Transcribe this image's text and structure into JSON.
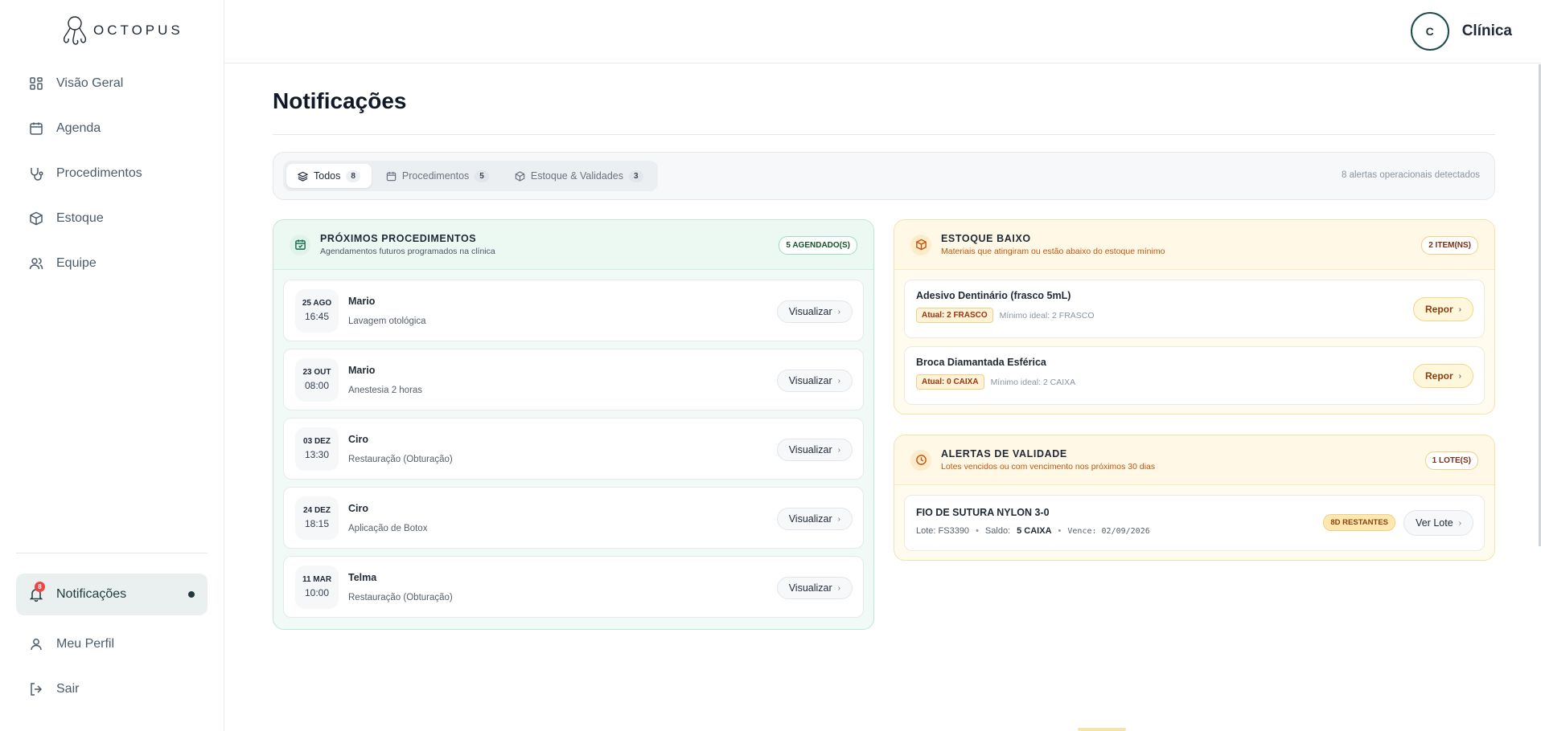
{
  "brand": {
    "name": "OCTOPUS",
    "logo_icon": "octopus-icon"
  },
  "sidebar": {
    "items": [
      {
        "label": "Visão Geral",
        "icon": "grid-icon"
      },
      {
        "label": "Agenda",
        "icon": "calendar-icon"
      },
      {
        "label": "Procedimentos",
        "icon": "stethoscope-icon"
      },
      {
        "label": "Estoque",
        "icon": "box-icon"
      },
      {
        "label": "Equipe",
        "icon": "users-icon"
      }
    ],
    "bottom": [
      {
        "label": "Notificações",
        "icon": "bell-icon",
        "badge": "8",
        "active": true
      },
      {
        "label": "Meu Perfil",
        "icon": "user-icon"
      },
      {
        "label": "Sair",
        "icon": "logout-icon"
      }
    ]
  },
  "header": {
    "avatar_initial": "C",
    "user_name": "Clínica"
  },
  "page": {
    "title": "Notificações"
  },
  "filters": {
    "tabs": [
      {
        "label": "Todos",
        "count": "8",
        "icon": "layers-icon",
        "active": true
      },
      {
        "label": "Procedimentos",
        "count": "5",
        "icon": "calendar-icon"
      },
      {
        "label": "Estoque & Validades",
        "count": "3",
        "icon": "box-icon"
      }
    ],
    "summary": "8 alertas operacionais detectados"
  },
  "procedures": {
    "title": "PRÓXIMOS PROCEDIMENTOS",
    "subtitle": "Agendamentos futuros programados na clínica",
    "pill": "5 AGENDADO(S)",
    "button_label": "Visualizar",
    "rows": [
      {
        "day": "25 AGO",
        "time": "16:45",
        "name": "Mario",
        "desc": "Lavagem otológica"
      },
      {
        "day": "23 OUT",
        "time": "08:00",
        "name": "Mario",
        "desc": "Anestesia 2 horas"
      },
      {
        "day": "03 DEZ",
        "time": "13:30",
        "name": "Ciro",
        "desc": "Restauração (Obturação)"
      },
      {
        "day": "24 DEZ",
        "time": "18:15",
        "name": "Ciro",
        "desc": "Aplicação de Botox"
      },
      {
        "day": "11 MAR",
        "time": "10:00",
        "name": "Telma",
        "desc": "Restauração (Obturação)"
      }
    ]
  },
  "low_stock": {
    "title": "ESTOQUE BAIXO",
    "subtitle": "Materiais que atingiram ou estão abaixo do estoque mínimo",
    "pill": "2 ITEM(NS)",
    "button_label": "Repor",
    "rows": [
      {
        "name": "Adesivo Dentinário (frasco 5mL)",
        "current": "Atual: 2 FRASCO",
        "minimum": "Mínimo ideal: 2 FRASCO"
      },
      {
        "name": "Broca Diamantada Esférica",
        "current": "Atual: 0 CAIXA",
        "minimum": "Mínimo ideal: 2 CAIXA"
      }
    ]
  },
  "validity": {
    "title": "ALERTAS DE VALIDADE",
    "subtitle": "Lotes vencidos ou com vencimento nos próximos 30 dias",
    "pill": "1 LOTE(S)",
    "rows": [
      {
        "name": "FIO DE SUTURA NYLON 3-0",
        "lot": "Lote: FS3390",
        "balance_label": "Saldo:",
        "balance_value": "5 CAIXA",
        "expires": "Vence: 02/09/2026",
        "remaining": "8D RESTANTES",
        "button_label": "Ver Lote"
      }
    ]
  },
  "colors": {
    "brand_dark": "#1f3a3a",
    "procedure_accent": "#166a4d",
    "stock_accent": "#c2560f",
    "badge_red": "#ef4444"
  }
}
